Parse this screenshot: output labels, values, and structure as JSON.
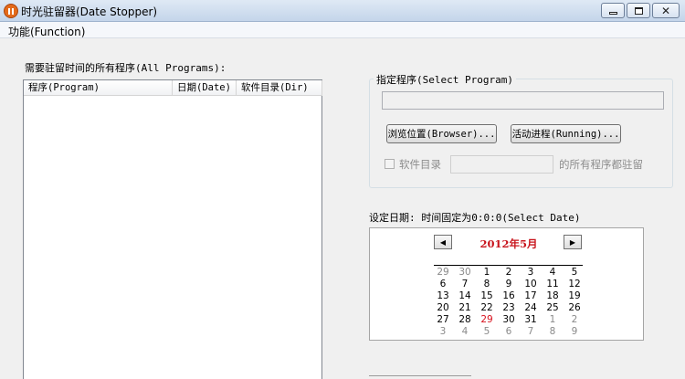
{
  "window": {
    "title": "时光驻留器(Date Stopper)"
  },
  "menu": {
    "function_label": "功能(Function)"
  },
  "programs": {
    "label": "需要驻留时间的所有程序(All Programs):",
    "columns": [
      "程序(Program)",
      "日期(Date)",
      "软件目录(Dir)"
    ]
  },
  "select_program": {
    "legend": "指定程序(Select Program)",
    "program_value": "",
    "browse_label": "浏览位置(Browser)...",
    "running_label": "活动进程(Running)...",
    "dir_checkbox_label": "软件目录",
    "dir_value": "",
    "dir_suffix": "的所有程序都驻留"
  },
  "set_date": {
    "label": "设定日期: 时间固定为0:0:0(Select Date)"
  },
  "calendar": {
    "title": "2012年5月",
    "prev_symbol": "◀",
    "next_symbol": "▶",
    "highlight_color": "#d8101c",
    "rows": [
      [
        "29",
        "30",
        "1",
        "2",
        "3",
        "4",
        "5"
      ],
      [
        "6",
        "7",
        "8",
        "9",
        "10",
        "11",
        "12"
      ],
      [
        "13",
        "14",
        "15",
        "16",
        "17",
        "18",
        "19"
      ],
      [
        "20",
        "21",
        "22",
        "23",
        "24",
        "25",
        "26"
      ],
      [
        "27",
        "28",
        "29",
        "30",
        "31",
        "1",
        "2"
      ],
      [
        "3",
        "4",
        "5",
        "6",
        "7",
        "8",
        "9"
      ]
    ],
    "today": "29"
  }
}
